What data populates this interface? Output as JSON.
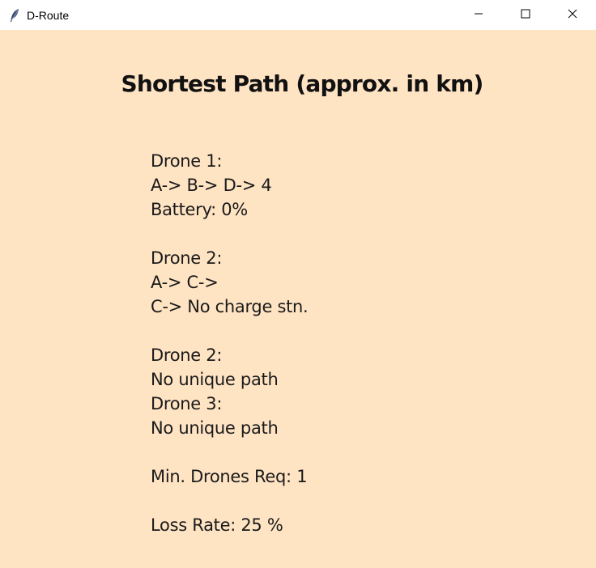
{
  "window": {
    "title": "D-Route",
    "icon": "feather-icon",
    "controls": [
      "minimize-icon",
      "maximize-icon",
      "close-icon"
    ]
  },
  "heading": "Shortest Path (approx. in km)",
  "results": {
    "lines": [
      "Drone 1:",
      "A-> B-> D-> 4",
      "Battery: 0%",
      "",
      "Drone 2:",
      "A-> C->",
      "C-> No charge stn.",
      "",
      "Drone 2:",
      "No unique path",
      "Drone 3:",
      "No unique path",
      "",
      "Min. Drones Req: 1",
      "",
      "Loss Rate: 25 %"
    ]
  },
  "colors": {
    "background": "#ffe4c4",
    "titlebar": "#ffffff",
    "text": "#1a1a1a"
  }
}
